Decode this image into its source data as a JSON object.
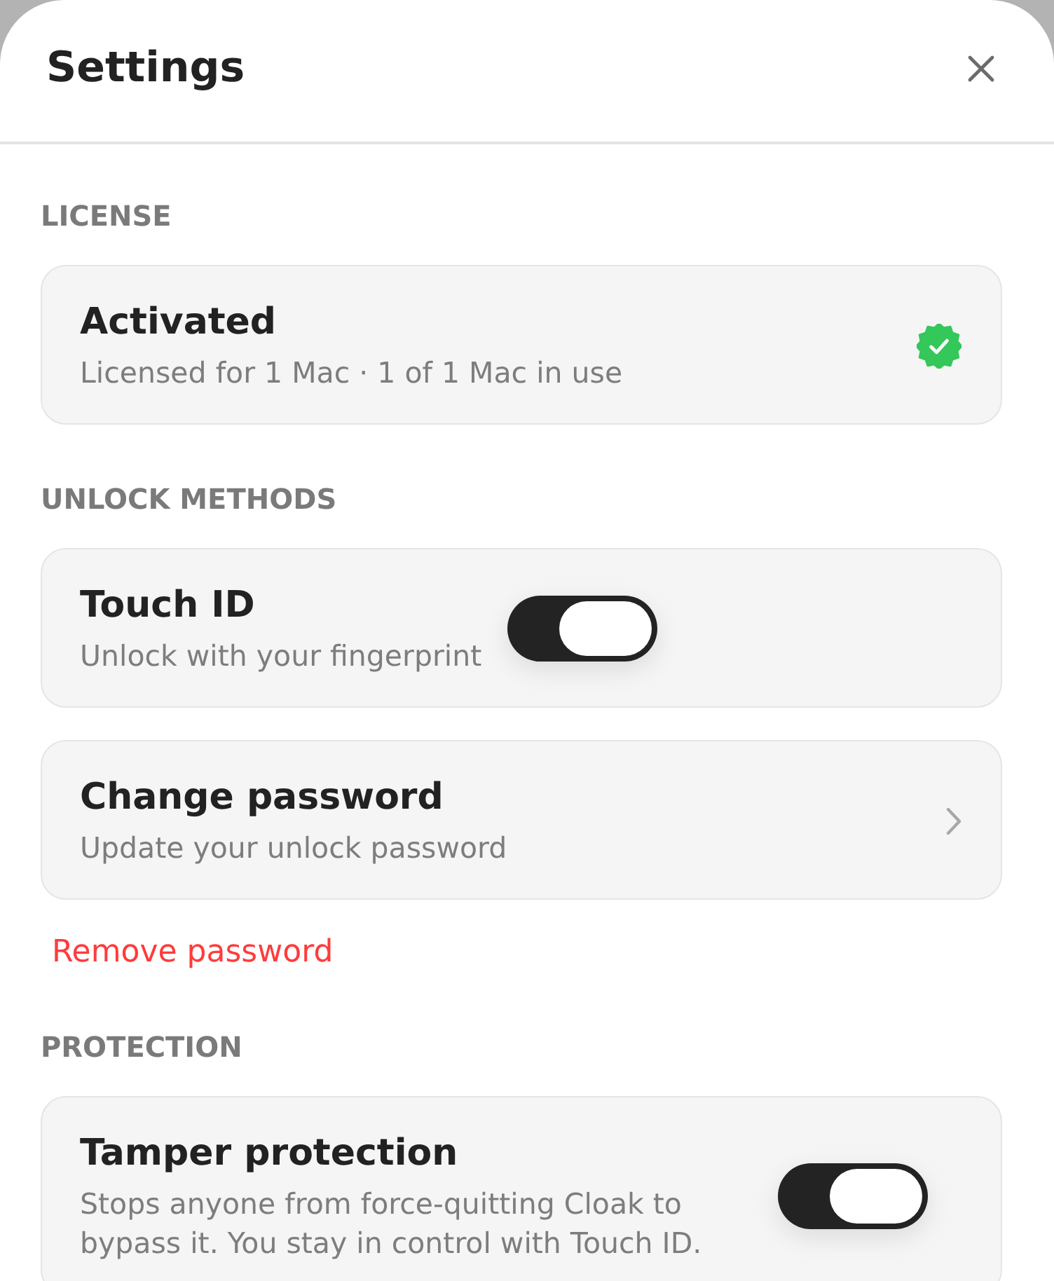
{
  "window": {
    "title": "Settings"
  },
  "sections": [
    {
      "heading": "LICENSE",
      "items": [
        {
          "kind": "status",
          "title": "Activated",
          "subtitle": "Licensed for 1 Mac · 1 of 1 Mac in use",
          "verified": true
        }
      ]
    },
    {
      "heading": "UNLOCK METHODS",
      "items": [
        {
          "kind": "toggle",
          "title": "Touch ID",
          "subtitle": "Unlock with your fingerprint",
          "on": true
        },
        {
          "kind": "link",
          "title": "Change password",
          "subtitle": "Update your unlock password"
        }
      ],
      "action": {
        "label": "Remove password"
      }
    },
    {
      "heading": "PROTECTION",
      "items": [
        {
          "kind": "toggle",
          "title": "Tamper protection",
          "subtitle": "Stops anyone from force-quitting Cloak to bypass it. You stay in control with Touch ID.",
          "on": true
        }
      ]
    }
  ]
}
